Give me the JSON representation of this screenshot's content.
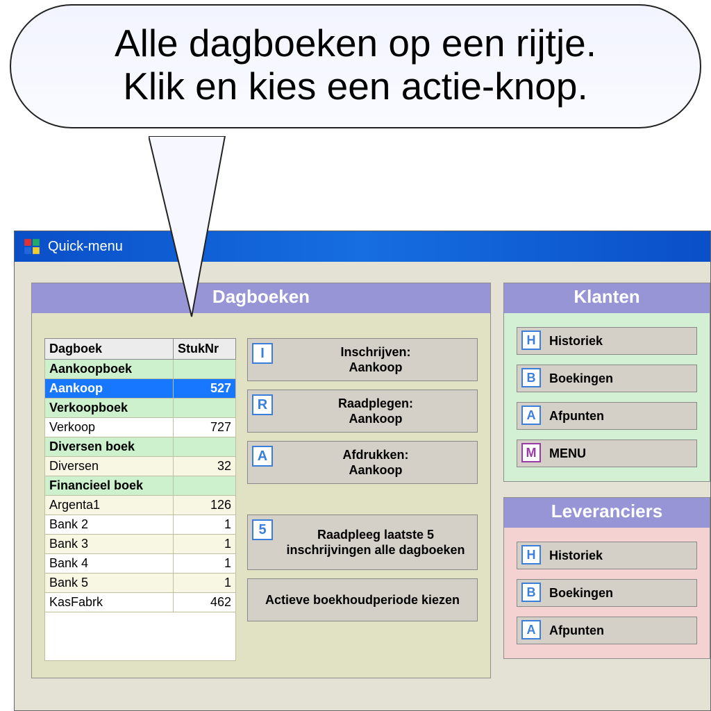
{
  "callout": {
    "line1": "Alle dagboeken op een rijtje.",
    "line2": "Klik en kies een actie-knop."
  },
  "window": {
    "title": "Quick-menu"
  },
  "dagboeken": {
    "title": "Dagboeken",
    "columns": {
      "dagboek": "Dagboek",
      "stuknr": "StukNr"
    },
    "rows": [
      {
        "type": "section",
        "label": "Aankoopboek",
        "val": ""
      },
      {
        "type": "selected",
        "label": "Aankoop",
        "val": "527"
      },
      {
        "type": "section",
        "label": "Verkoopboek",
        "val": ""
      },
      {
        "type": "plain",
        "label": "Verkoop",
        "val": "727"
      },
      {
        "type": "section",
        "label": "Diversen boek",
        "val": ""
      },
      {
        "type": "alt",
        "label": "Diversen",
        "val": "32"
      },
      {
        "type": "section",
        "label": "Financieel boek",
        "val": ""
      },
      {
        "type": "alt",
        "label": "Argenta1",
        "val": "126"
      },
      {
        "type": "plain",
        "label": "Bank 2",
        "val": "1"
      },
      {
        "type": "alt",
        "label": "Bank 3",
        "val": "1"
      },
      {
        "type": "plain",
        "label": "Bank 4",
        "val": "1"
      },
      {
        "type": "alt",
        "label": "Bank 5",
        "val": "1"
      },
      {
        "type": "plain",
        "label": "KasFabrk",
        "val": "462"
      }
    ],
    "actions": {
      "inschrijven": {
        "key": "I",
        "label": "Inschrijven:\nAankoop"
      },
      "raadplegen": {
        "key": "R",
        "label": "Raadplegen:\nAankoop"
      },
      "afdrukken": {
        "key": "A",
        "label": "Afdrukken:\nAankoop"
      },
      "laatste5": {
        "key": "5",
        "label": "Raadpleeg laatste 5 inschrijvingen alle dagboeken"
      },
      "periode": {
        "label": "Actieve boekhoudperiode kiezen"
      }
    }
  },
  "klanten": {
    "title": "Klanten",
    "buttons": {
      "historiek": {
        "key": "H",
        "label": "Historiek"
      },
      "boekingen": {
        "key": "B",
        "label": "Boekingen"
      },
      "afpunten": {
        "key": "A",
        "label": "Afpunten"
      },
      "menu": {
        "key": "M",
        "label": "MENU"
      }
    }
  },
  "leveranciers": {
    "title": "Leveranciers",
    "buttons": {
      "historiek": {
        "key": "H",
        "label": "Historiek"
      },
      "boekingen": {
        "key": "B",
        "label": "Boekingen"
      },
      "afpunten": {
        "key": "A",
        "label": "Afpunten"
      }
    }
  }
}
